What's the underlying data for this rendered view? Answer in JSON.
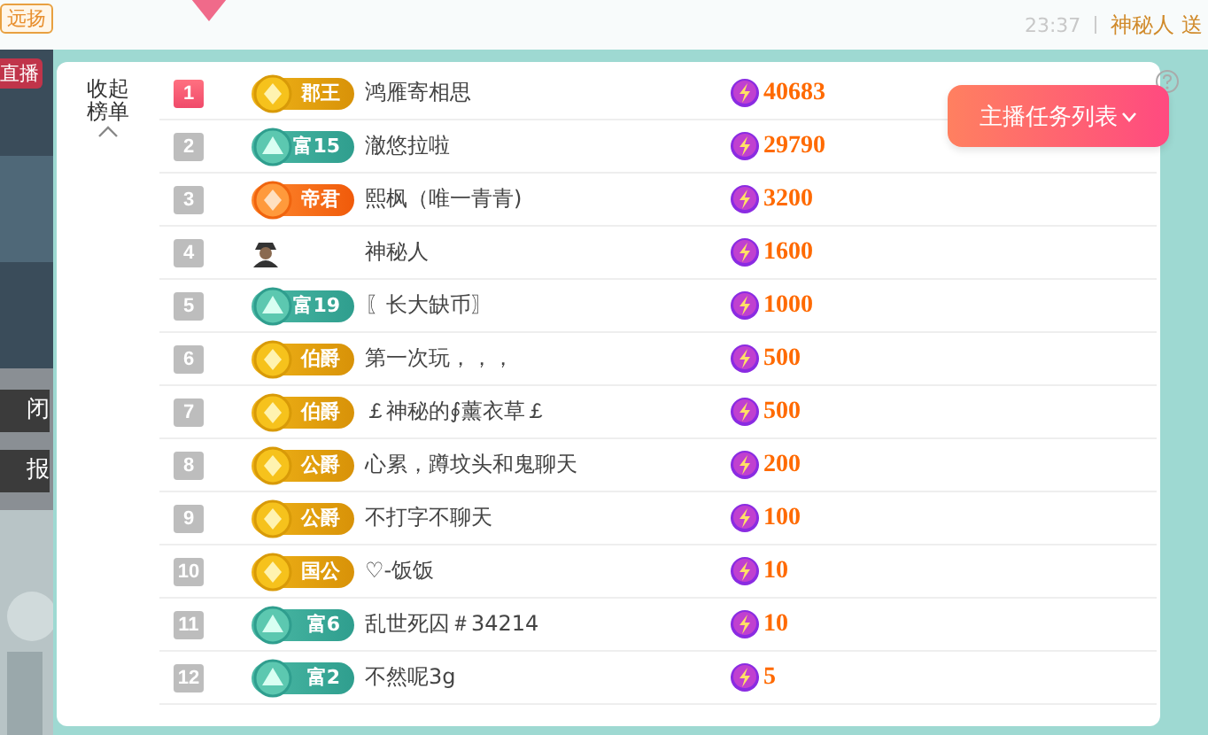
{
  "top_bar": {
    "tag": "远扬",
    "time": "23:37",
    "message": "神秘人 送"
  },
  "video_strip": {
    "kind": "picture",
    "live_tag": "直播",
    "labels": [
      "闭",
      "报"
    ]
  },
  "panel": {
    "collapse": "收起榜单",
    "task_button": "主播任务列表",
    "rows": [
      {
        "rank": "1",
        "top": true,
        "badge": {
          "kind": "gold",
          "label": "郡王"
        },
        "name": "鸿雁寄相思",
        "score": "40683"
      },
      {
        "rank": "2",
        "top": false,
        "badge": {
          "kind": "teal",
          "label": "富15"
        },
        "name": "澈悠拉啦",
        "score": "29790"
      },
      {
        "rank": "3",
        "top": false,
        "badge": {
          "kind": "orange",
          "label": "帝君"
        },
        "name": "熙枫（唯一青青)",
        "score": "3200"
      },
      {
        "rank": "4",
        "top": false,
        "badge": {
          "kind": "mystery"
        },
        "name": "神秘人",
        "score": "1600"
      },
      {
        "rank": "5",
        "top": false,
        "badge": {
          "kind": "teal",
          "label": "富19"
        },
        "name": "〖长大缺币〗",
        "score": "1000"
      },
      {
        "rank": "6",
        "top": false,
        "badge": {
          "kind": "gold",
          "label": "伯爵"
        },
        "name": "第一次玩，，，",
        "score": "500"
      },
      {
        "rank": "7",
        "top": false,
        "badge": {
          "kind": "gold",
          "label": "伯爵"
        },
        "name": "￡神秘的∮薰衣草￡",
        "score": "500"
      },
      {
        "rank": "8",
        "top": false,
        "badge": {
          "kind": "gold",
          "label": "公爵"
        },
        "name": "心累，蹲坟头和鬼聊天",
        "score": "200"
      },
      {
        "rank": "9",
        "top": false,
        "badge": {
          "kind": "gold",
          "label": "公爵"
        },
        "name": "不打字不聊天",
        "score": "100"
      },
      {
        "rank": "10",
        "top": false,
        "badge": {
          "kind": "gold",
          "label": "国公"
        },
        "name": "♡-饭饭",
        "score": "10"
      },
      {
        "rank": "11",
        "top": false,
        "badge": {
          "kind": "teal",
          "label": "富6"
        },
        "name": "乱世死囚＃34214",
        "score": "10"
      },
      {
        "rank": "12",
        "top": false,
        "badge": {
          "kind": "teal",
          "label": "富2"
        },
        "name": "不然呢3g",
        "score": "5"
      }
    ]
  }
}
